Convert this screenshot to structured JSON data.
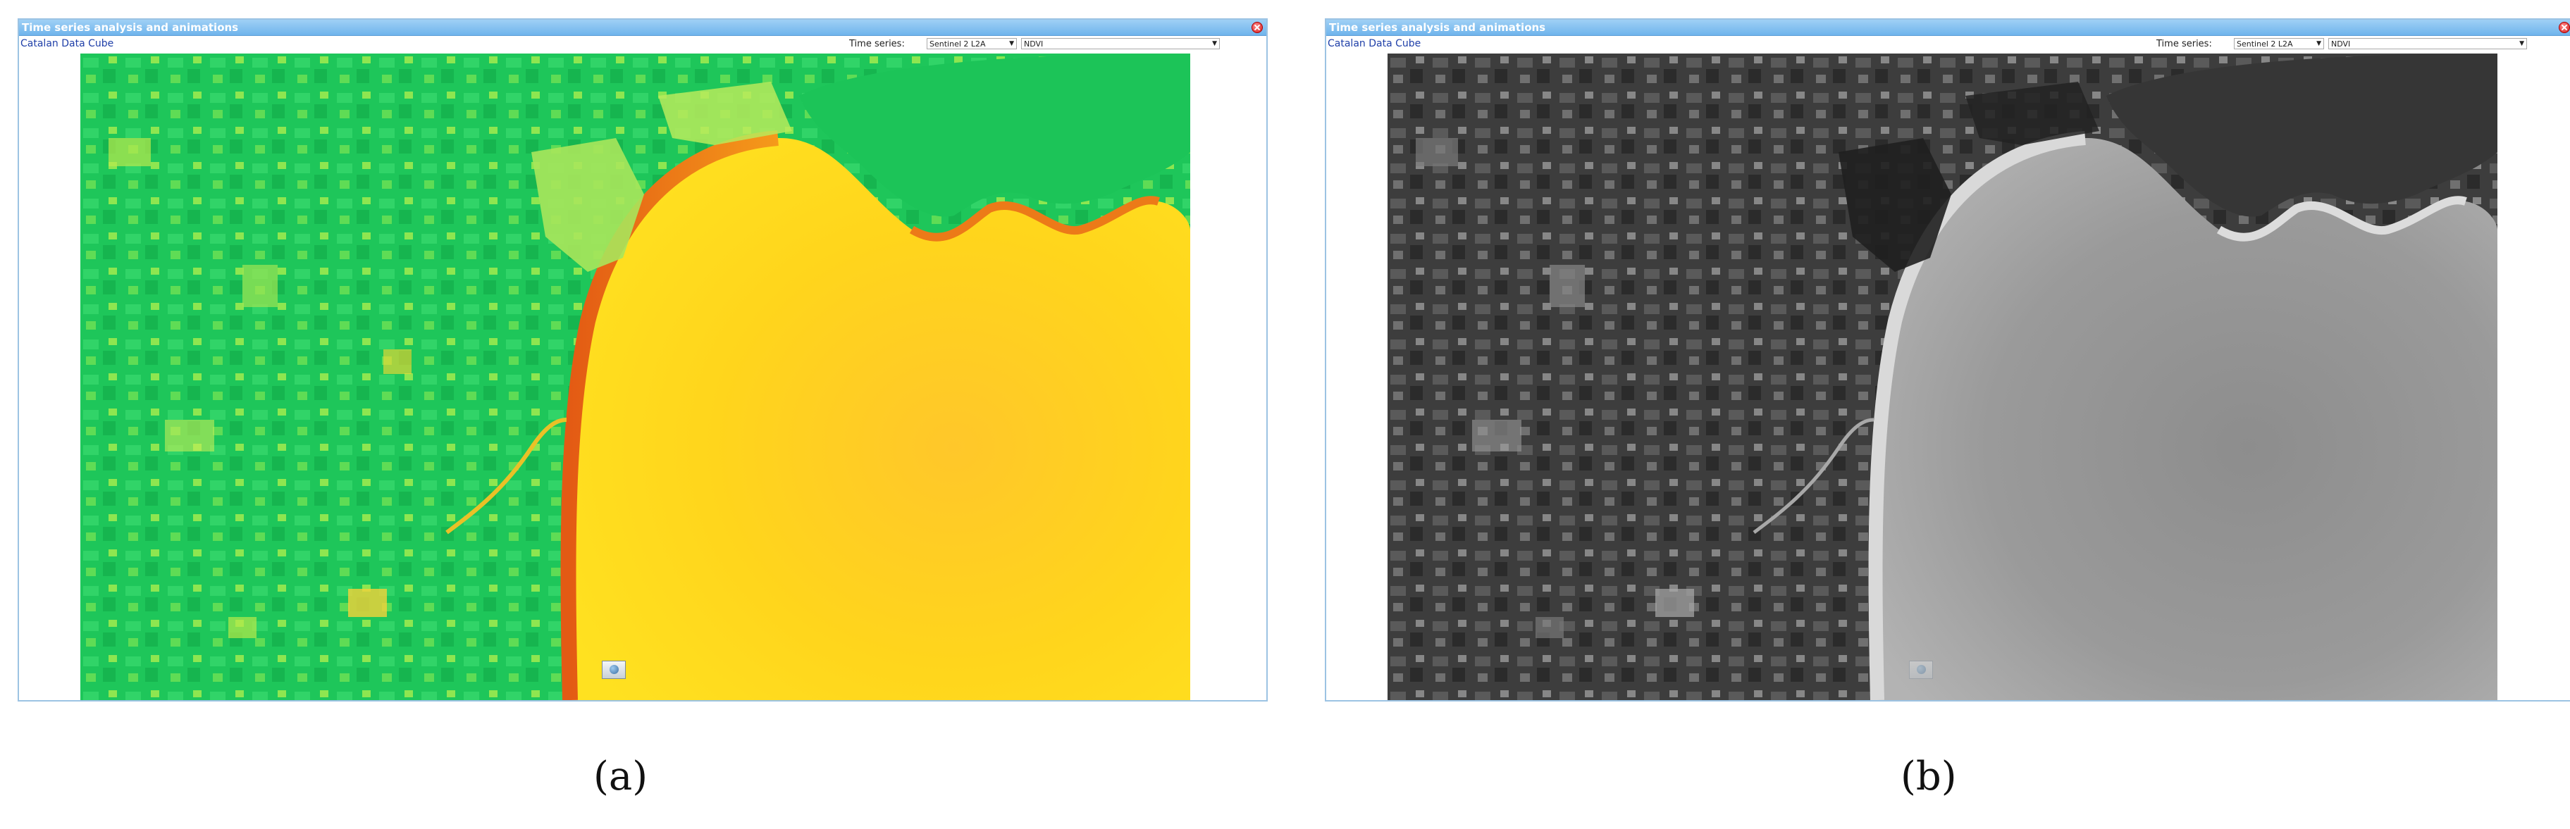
{
  "panels": [
    {
      "title": "Time series analysis and animations",
      "brand": "Catalan Data Cube",
      "time_series_label": "Time series:",
      "series_select": "Sentinel 2 L2A",
      "product_select": "NDVI",
      "caption": "(a)"
    },
    {
      "title": "Time series analysis and animations",
      "brand": "Catalan Data Cube",
      "time_series_label": "Time series:",
      "series_select": "Sentinel 2 L2A",
      "product_select": "NDVI",
      "caption": "(b)"
    }
  ],
  "icons": {
    "close": "close-icon",
    "dropdown": "chevron-down-icon",
    "map_tool": "globe-icon"
  },
  "colors": {
    "titlebar": "#7fbdef",
    "link": "#1f3fa8",
    "ndvi_high": "#1fc95a",
    "ndvi_mid": "#b8e84a",
    "ndvi_low": "#ffd21c",
    "ndvi_lowest": "#e8541a"
  }
}
